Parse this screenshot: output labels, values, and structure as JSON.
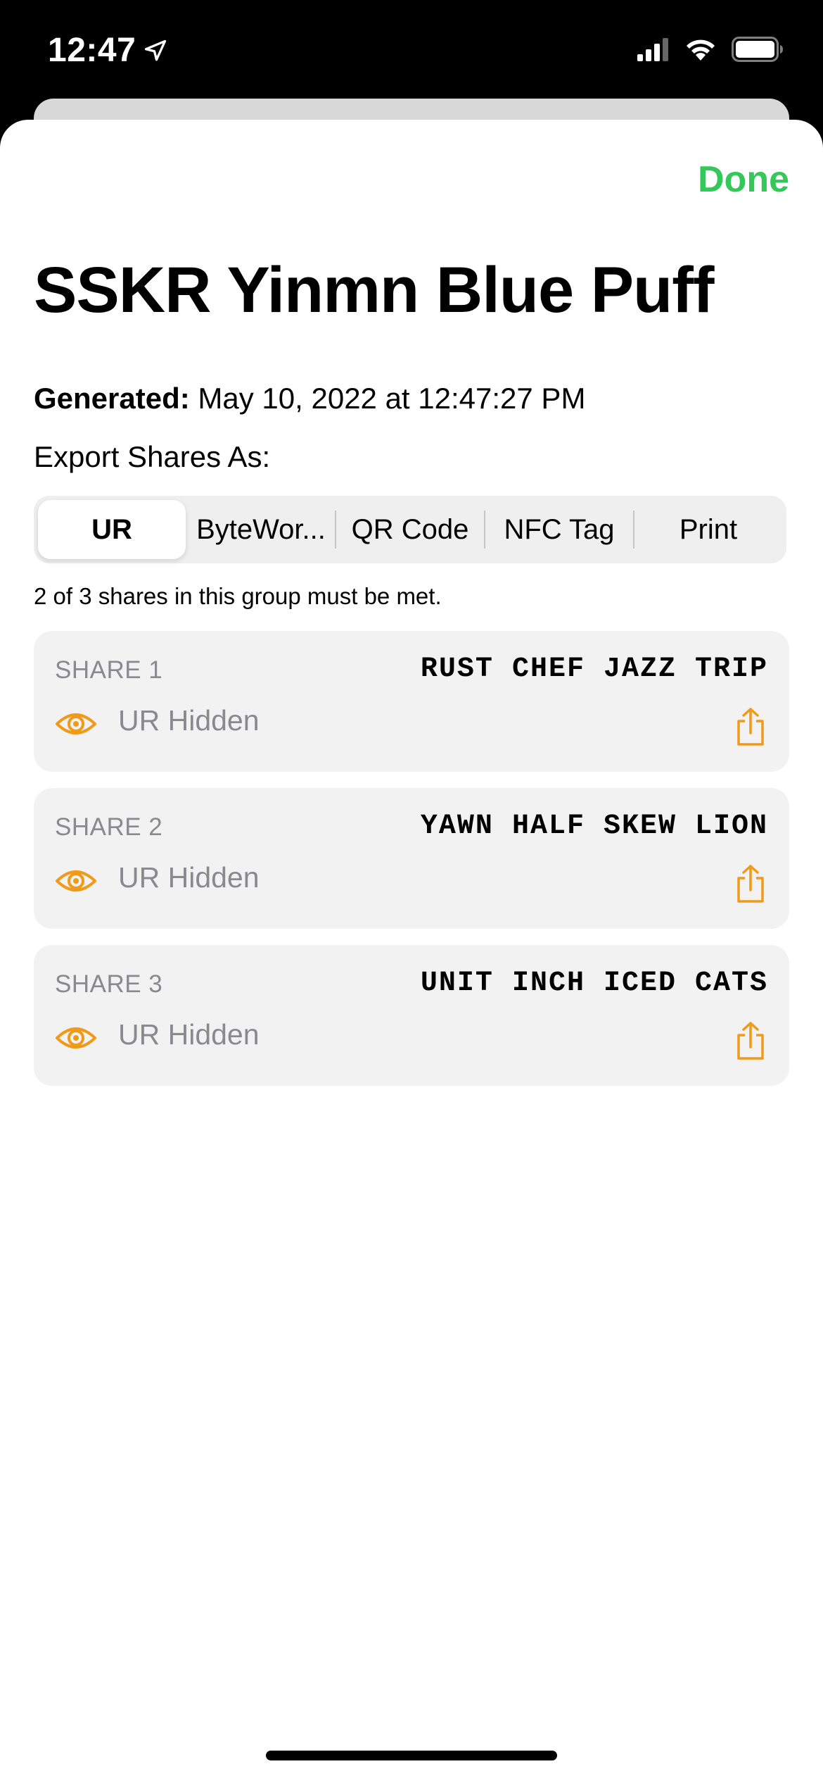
{
  "status_bar": {
    "time": "12:47"
  },
  "sheet": {
    "done_label": "Done",
    "title": "SSKR Yinmn Blue Puff",
    "generated_label": "Generated:",
    "generated_value": "May 10, 2022 at 12:47:27 PM",
    "export_label": "Export Shares As:",
    "segments": [
      {
        "label": "UR",
        "selected": true
      },
      {
        "label": "ByteWor...",
        "selected": false
      },
      {
        "label": "QR Code",
        "selected": false
      },
      {
        "label": "NFC Tag",
        "selected": false
      },
      {
        "label": "Print",
        "selected": false
      }
    ],
    "threshold_note": "2 of 3 shares in this group must be met.",
    "shares": [
      {
        "label": "SHARE 1",
        "words": "RUST CHEF JAZZ TRIP",
        "status": "UR Hidden"
      },
      {
        "label": "SHARE 2",
        "words": "YAWN HALF SKEW LION",
        "status": "UR Hidden"
      },
      {
        "label": "SHARE 3",
        "words": "UNIT INCH ICED CATS",
        "status": "UR Hidden"
      }
    ]
  },
  "colors": {
    "accent_green": "#34c759",
    "accent_orange": "#f09a1a"
  },
  "icons": [
    "location-arrow-icon",
    "cellular-signal-icon",
    "wifi-icon",
    "battery-icon",
    "eye-icon",
    "share-icon"
  ]
}
